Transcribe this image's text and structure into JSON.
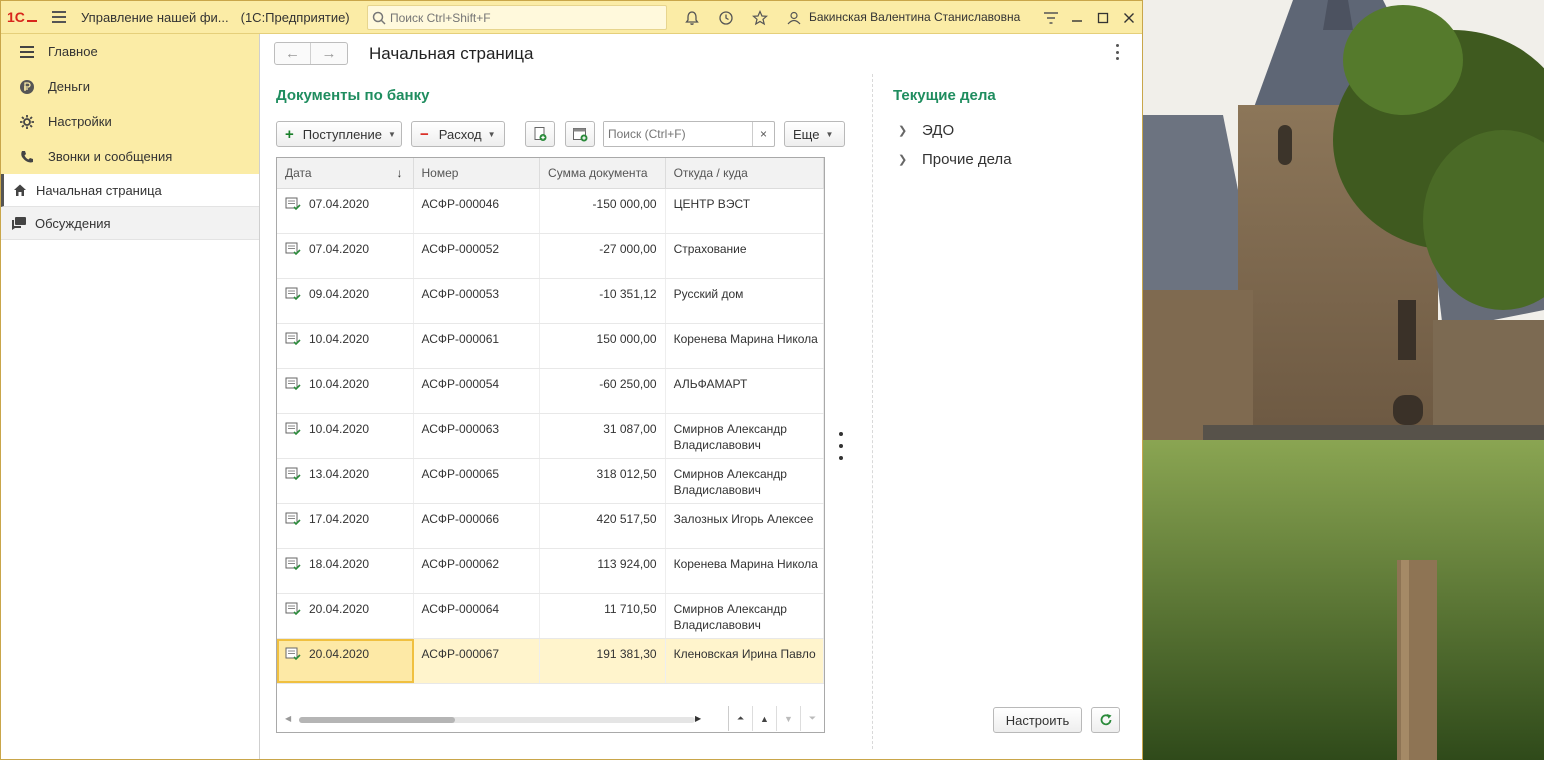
{
  "titlebar": {
    "logo": "1С",
    "app_title": "Управление нашей фи...",
    "app_mode": "(1С:Предприятие)",
    "search_placeholder": "Поиск Ctrl+Shift+F",
    "user_name": "Бакинская Валентина Станиславовна",
    "icons": [
      "bell-icon",
      "history-icon",
      "star-icon",
      "users-icon",
      "settings-menu-icon",
      "minimize-icon",
      "maximize-icon",
      "close-icon"
    ]
  },
  "sidebar": {
    "sections": [
      {
        "label": "Главное",
        "icon": "menu-lines-icon"
      },
      {
        "label": "Деньги",
        "icon": "ruble-icon"
      },
      {
        "label": "Настройки",
        "icon": "gear-icon"
      },
      {
        "label": "Звонки и сообщения",
        "icon": "phone-icon"
      }
    ],
    "open_windows": [
      {
        "label": "Начальная страница",
        "icon": "home-icon",
        "active": true
      },
      {
        "label": "Обсуждения",
        "icon": "chat-icon",
        "active": false
      }
    ]
  },
  "page": {
    "title": "Начальная страница",
    "left_section_title": "Документы по банку",
    "right_section_title": "Текущие дела"
  },
  "toolbar": {
    "income_label": "Поступление",
    "expense_label": "Расход",
    "more_label": "Еще",
    "search_placeholder": "Поиск (Ctrl+F)",
    "clear_label": "×"
  },
  "table": {
    "headers": [
      "Дата",
      "Номер",
      "Сумма документа",
      "Откуда / куда"
    ],
    "sort_indicator": "↓",
    "rows": [
      {
        "date": "07.04.2020",
        "number": "АСФР-000046",
        "sum": "-150 000,00",
        "sign": "neg",
        "from": [
          "ЦЕНТР ВЭСТ"
        ]
      },
      {
        "date": "07.04.2020",
        "number": "АСФР-000052",
        "sum": "-27 000,00",
        "sign": "neg",
        "from": [
          "Страхование"
        ]
      },
      {
        "date": "09.04.2020",
        "number": "АСФР-000053",
        "sum": "-10 351,12",
        "sign": "neg",
        "from": [
          "Русский дом"
        ]
      },
      {
        "date": "10.04.2020",
        "number": "АСФР-000061",
        "sum": "150 000,00",
        "sign": "pos",
        "from": [
          "Коренева Марина Никола"
        ]
      },
      {
        "date": "10.04.2020",
        "number": "АСФР-000054",
        "sum": "-60 250,00",
        "sign": "neg",
        "from": [
          "АЛЬФАМАРТ"
        ]
      },
      {
        "date": "10.04.2020",
        "number": "АСФР-000063",
        "sum": "31 087,00",
        "sign": "pos",
        "from": [
          "Смирнов Александр",
          "Владиславович"
        ]
      },
      {
        "date": "13.04.2020",
        "number": "АСФР-000065",
        "sum": "318 012,50",
        "sign": "pos",
        "from": [
          "Смирнов Александр",
          "Владиславович"
        ]
      },
      {
        "date": "17.04.2020",
        "number": "АСФР-000066",
        "sum": "420 517,50",
        "sign": "pos",
        "from": [
          "Залозных Игорь Алексее"
        ]
      },
      {
        "date": "18.04.2020",
        "number": "АСФР-000062",
        "sum": "113 924,00",
        "sign": "pos",
        "from": [
          "Коренева Марина Никола"
        ]
      },
      {
        "date": "20.04.2020",
        "number": "АСФР-000064",
        "sum": "11 710,50",
        "sign": "pos",
        "from": [
          "Смирнов Александр",
          "Владиславович"
        ]
      },
      {
        "date": "20.04.2020",
        "number": "АСФР-000067",
        "sum": "191 381,30",
        "sign": "pos",
        "from": [
          "Кленовская Ирина Павло"
        ],
        "selected": true
      }
    ]
  },
  "tasks": {
    "items": [
      {
        "label": "ЭДО"
      },
      {
        "label": "Прочие дела"
      }
    ],
    "setup_label": "Настроить"
  },
  "colors": {
    "titlebar_bg": "#fbeca6",
    "accent_green": "#1f8d5f",
    "negative": "#d9261c",
    "positive": "#1a7f2a",
    "selected_row": "#fff4cc"
  }
}
